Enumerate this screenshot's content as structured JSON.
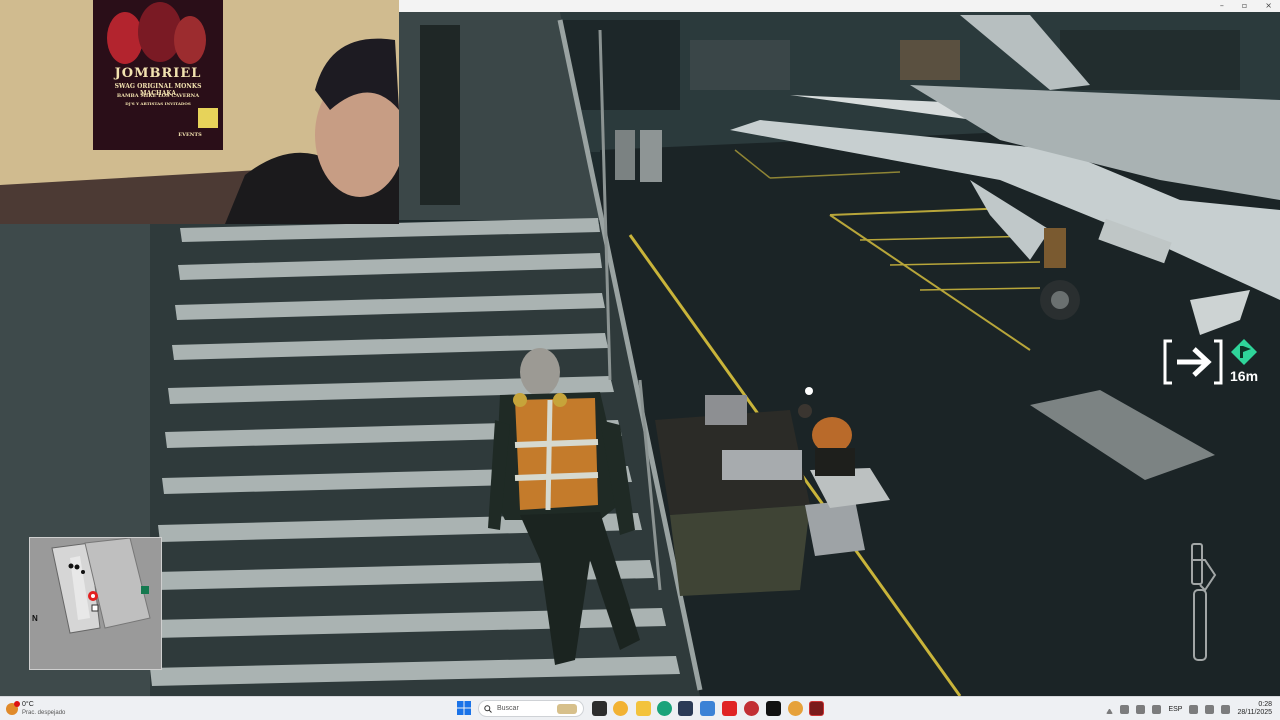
{
  "poster": {
    "headline": "JOMBRIEL",
    "line1": "SWAG ORIGINAL  MONKS  MACHAKA",
    "line2": "BAMBA MIKE  LOS CAVERNA",
    "line3": "DJ'S Y ARTISTAS INVITADOS",
    "footer": "EVENTS"
  },
  "hud": {
    "objective_distance": "16m",
    "objective_icon": "arrow-right-icon",
    "target_icon": "green-diamond-marker-icon",
    "equipped_item_icon": "pipe-wrench-icon",
    "minimap_north": "N"
  },
  "window": {
    "minimize": "–",
    "maximize": "▫",
    "close": "×"
  },
  "taskbar": {
    "weather_temp": "0°C",
    "weather_condition": "Prac. despejado",
    "search_placeholder": "Buscar",
    "language": "ESP",
    "time": "0:28",
    "date": "28/11/2025"
  },
  "colors": {
    "hud_accent": "#2fd59a",
    "taskbar_bg": "#eef0f3",
    "floor_line": "#c9b43a"
  }
}
